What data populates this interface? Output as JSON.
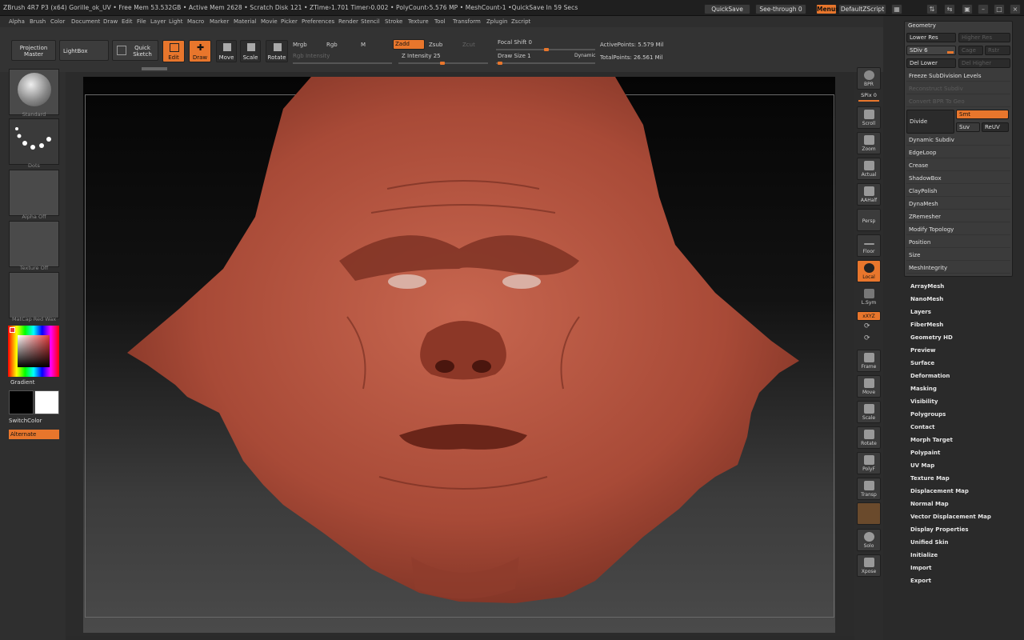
{
  "title_bar": {
    "status": "ZBrush 4R7 P3 (x64)   Gorille_ok_UV   • Free Mem 53.532GB • Active Mem 2628 • Scratch Disk 121 • ZTime›1.701 Timer›0.002 • PolyCount›5.576 MP • MeshCount›1   •QuickSave In 59 Secs",
    "quicksave": "QuickSave",
    "see_through": "See-through  0",
    "menus": "Menus",
    "default_zscript": "DefaultZScript"
  },
  "menu_bar": [
    "Alpha",
    "Brush",
    "Color",
    "Document",
    "Draw",
    "Edit",
    "File",
    "Layer",
    "Light",
    "Macro",
    "Marker",
    "Material",
    "Movie",
    "Picker",
    "Preferences",
    "Render",
    "Stencil",
    "Stroke",
    "Texture",
    "Tool",
    "Transform",
    "Zplugin",
    "Zscript"
  ],
  "shelf": {
    "projection_master": "Projection Master",
    "lightbox": "LightBox",
    "quick_sketch": "Quick Sketch",
    "edit": "Edit",
    "draw": "Draw",
    "move": "Move",
    "scale": "Scale",
    "rotate": "Rotate",
    "mrgb": "Mrgb",
    "rgb": "Rgb",
    "m": "M",
    "zadd": "Zadd",
    "zsub": "Zsub",
    "zcut": "Zcut",
    "rgb_intensity": "Rgb Intensity",
    "z_intensity": "Z Intensity 25",
    "focal_shift": "Focal Shift 0",
    "draw_size": "Draw Size 1",
    "dynamic": "Dynamic",
    "active_points": "ActivePoints: 5.579  Mil",
    "total_points": "TotalPoints: 26.561  Mil"
  },
  "left_shelf": {
    "brush": "Standard",
    "stroke": "Dots",
    "alpha": "Alpha  Off",
    "texture": "Texture  Off",
    "material": "MatCap Red Wax",
    "gradient": "Gradient",
    "switch_color": "SwitchColor",
    "alternate": "Alternate"
  },
  "right_toolbar": [
    {
      "label": "BPR",
      "icon": "bpr-icon",
      "active": false
    },
    {
      "label": "SPix 0",
      "icon": "",
      "active": false
    },
    {
      "label": "Scroll",
      "icon": "scroll-icon",
      "active": false
    },
    {
      "label": "Zoom",
      "icon": "zoom-icon",
      "active": false
    },
    {
      "label": "Actual",
      "icon": "actual-icon",
      "active": false
    },
    {
      "label": "AAHalf",
      "icon": "aahalf-icon",
      "active": false
    },
    {
      "label": "Persp",
      "icon": "persp-icon",
      "active": false
    },
    {
      "label": "Floor",
      "icon": "floor-icon",
      "active": false
    },
    {
      "label": "Local",
      "icon": "local-icon",
      "active": true
    },
    {
      "label": "L.Sym",
      "icon": "lsym-icon",
      "active": false
    },
    {
      "label": "xXYZ",
      "icon": "",
      "active": true
    },
    {
      "label": "Frame",
      "icon": "frame-icon",
      "active": false
    },
    {
      "label": "Move",
      "icon": "move-icon",
      "active": false
    },
    {
      "label": "Scale",
      "icon": "scale-icon",
      "active": false
    },
    {
      "label": "Rotate",
      "icon": "rotate-icon",
      "active": false
    },
    {
      "label": "PolyF",
      "icon": "polyf-icon",
      "active": false
    },
    {
      "label": "Transp",
      "icon": "transp-icon",
      "active": false
    },
    {
      "label": "Solo",
      "icon": "solo-icon",
      "active": false
    },
    {
      "label": "Xpose",
      "icon": "xpose-icon",
      "active": false
    }
  ],
  "geometry": {
    "header": "Geometry",
    "lower_res": "Lower Res",
    "higher_res": "Higher Res",
    "sdiv": "SDiv 6",
    "cage": "Cage",
    "rstr": "Rstr",
    "del_lower": "Del Lower",
    "del_higher": "Del Higher",
    "freeze": "Freeze SubDivision Levels",
    "reconstruct": "Reconstruct Subdiv",
    "convert_bpr": "Convert BPR To Geo",
    "divide": "Divide",
    "smt": "Smt",
    "suv": "Suv",
    "reuv": "ReUV",
    "items": [
      "Dynamic Subdiv",
      "EdgeLoop",
      "Crease",
      "ShadowBox",
      "ClayPolish",
      "DynaMesh",
      "ZRemesher",
      "Modify Topology",
      "Position",
      "Size",
      "MeshIntegrity"
    ]
  },
  "tool_menu": [
    "ArrayMesh",
    "NanoMesh",
    "Layers",
    "FiberMesh",
    "Geometry HD",
    "Preview",
    "Surface",
    "Deformation",
    "Masking",
    "Visibility",
    "Polygroups",
    "Contact",
    "Morph Target",
    "Polypaint",
    "UV Map",
    "Texture Map",
    "Displacement Map",
    "Normal Map",
    "Vector Displacement Map",
    "Display Properties",
    "Unified Skin",
    "Initialize",
    "Import",
    "Export"
  ],
  "colors": {
    "accent": "#e8762c",
    "model": "#b2533f"
  }
}
